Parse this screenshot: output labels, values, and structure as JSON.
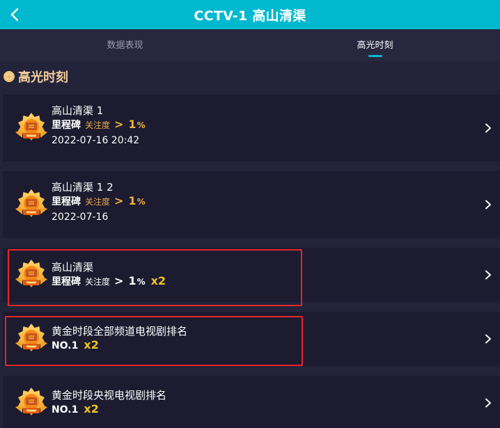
{
  "header": {
    "title": "CCTV-1 高山清渠",
    "back_icon": "chevron-left-icon",
    "background": "#00b9cf"
  },
  "tabs": [
    {
      "label": "数据表现",
      "active": false
    },
    {
      "label": "高光时刻",
      "active": true
    }
  ],
  "section": {
    "title": "高光时刻",
    "icon": "gold-dot-icon"
  },
  "cards": [
    {
      "title": "高山清渠 1",
      "stat": {
        "label": "里程碑",
        "metric": "关注度",
        "symbol": ">",
        "value": "1",
        "unit": "%"
      },
      "date": "2022-07-16 20:42"
    },
    {
      "title": "高山清渠 1 2",
      "stat": {
        "label": "里程碑",
        "metric": "关注度",
        "symbol": ">",
        "value": "1",
        "unit": "%"
      },
      "date": "2022-07-16"
    },
    {
      "title": "高山清渠",
      "stat": {
        "label": "里程碑",
        "metric": "关注度",
        "symbol": ">",
        "value": "1",
        "unit": "%",
        "multiplier": "x2"
      }
    },
    {
      "title": "黄金时段全部频道电视剧排名",
      "stat": {
        "label": "NO.1",
        "multiplier": "x2"
      }
    },
    {
      "title": "黄金时段央视电视剧排名",
      "stat": {
        "label": "NO.1",
        "multiplier": "x2"
      }
    }
  ],
  "colors": {
    "page_bg": "#23233a",
    "card_bg": "#1c1b2f",
    "accent_gold": "#f0b13c",
    "highlight_border": "#e8262a"
  }
}
